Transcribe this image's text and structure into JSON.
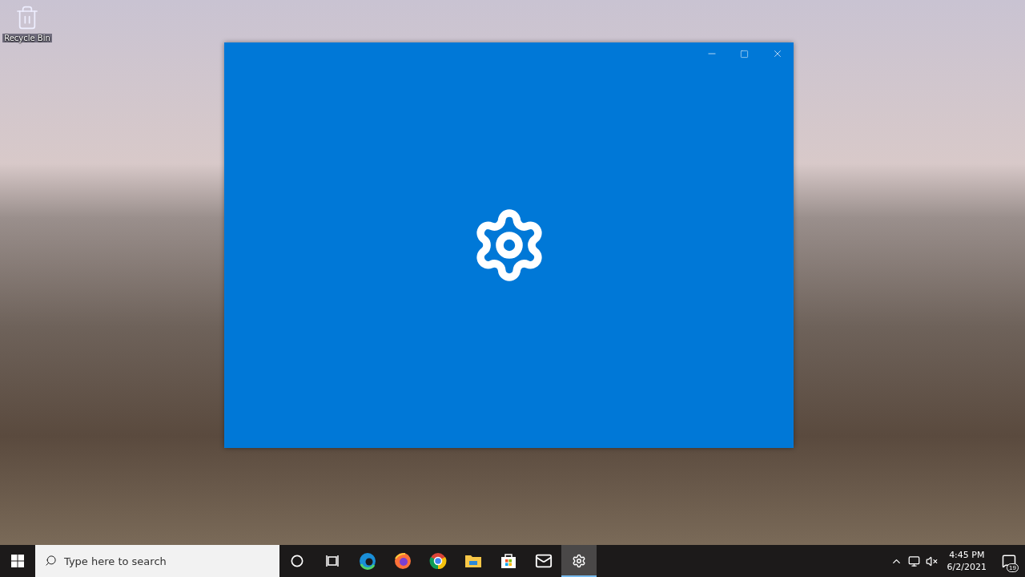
{
  "desktop_icons": [
    {
      "label": "Recycle Bin"
    }
  ],
  "taskbar": {
    "search": {
      "placeholder": "Type here to search"
    },
    "apps": [
      {
        "kind": "cortana",
        "selected": false
      },
      {
        "kind": "taskview",
        "selected": false
      },
      {
        "kind": "edge",
        "selected": false
      },
      {
        "kind": "firefox",
        "selected": false
      },
      {
        "kind": "chrome",
        "selected": false
      },
      {
        "kind": "explorer",
        "selected": false
      },
      {
        "kind": "store",
        "selected": false
      },
      {
        "kind": "mail",
        "selected": false
      },
      {
        "kind": "settings",
        "selected": true
      }
    ],
    "tray": {
      "time": "4:45 PM",
      "date": "6/2/2021",
      "notifications": "19"
    }
  }
}
